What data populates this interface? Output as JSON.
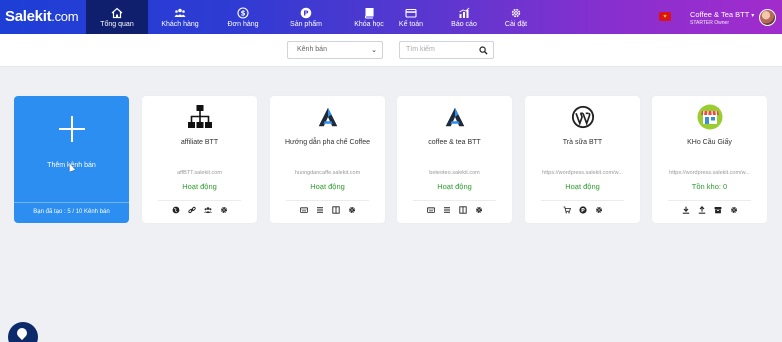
{
  "app": {
    "logo_main": "Salekit",
    "logo_suffix": ".com"
  },
  "nav": [
    {
      "label": "Tổng quan",
      "icon": "home-icon",
      "active": true
    },
    {
      "label": "Khách hàng",
      "icon": "users-icon"
    },
    {
      "label": "Đơn hàng",
      "icon": "dollar-icon"
    },
    {
      "label": "Sản phẩm",
      "icon": "product-icon"
    },
    {
      "label": "Khóa học",
      "icon": "book-icon"
    },
    {
      "label": "Kế toán",
      "icon": "card-icon"
    },
    {
      "label": "Báo cáo",
      "icon": "chart-icon"
    },
    {
      "label": "Cài đặt",
      "icon": "gear-icon"
    }
  ],
  "account": {
    "name": "Coffee & Tea BTT",
    "plan": "STARTER",
    "role": "Owner"
  },
  "filters": {
    "channel_select": "Kênh bán",
    "search_placeholder": "Tìm kiếm"
  },
  "add_card": {
    "label": "Thêm kênh bán",
    "usage": "Bạn đã tạo : 5 / 10 Kênh bán"
  },
  "channels": [
    {
      "name": "affiliate BTT",
      "url": "affBTT.salekit.com",
      "status": "Hoạt động",
      "icon": "sitemap-icon"
    },
    {
      "name": "Hướng dẫn pha chế Coffee",
      "url": "huongdancaffe.salekit.com",
      "status": "Hoạt động",
      "icon": "salekit-logo-icon"
    },
    {
      "name": "coffee & tea BTT",
      "url": "beteoteo.salekit.com",
      "status": "Hoạt động",
      "icon": "salekit-logo-icon"
    },
    {
      "name": "Trà sữa BTT",
      "url": "https://wordpress.salekit.com/w...",
      "status": "Hoạt động",
      "icon": "wordpress-icon"
    },
    {
      "name": "KHo Cầu Giấy",
      "url": "https://wordpress.salekit.com/w...",
      "status": "Tồn kho: 0",
      "icon": "store-icon"
    }
  ],
  "colors": {
    "accent": "#2c8ef0",
    "status_green": "#2a9d2a",
    "nav_active": "#0f1f6e"
  }
}
